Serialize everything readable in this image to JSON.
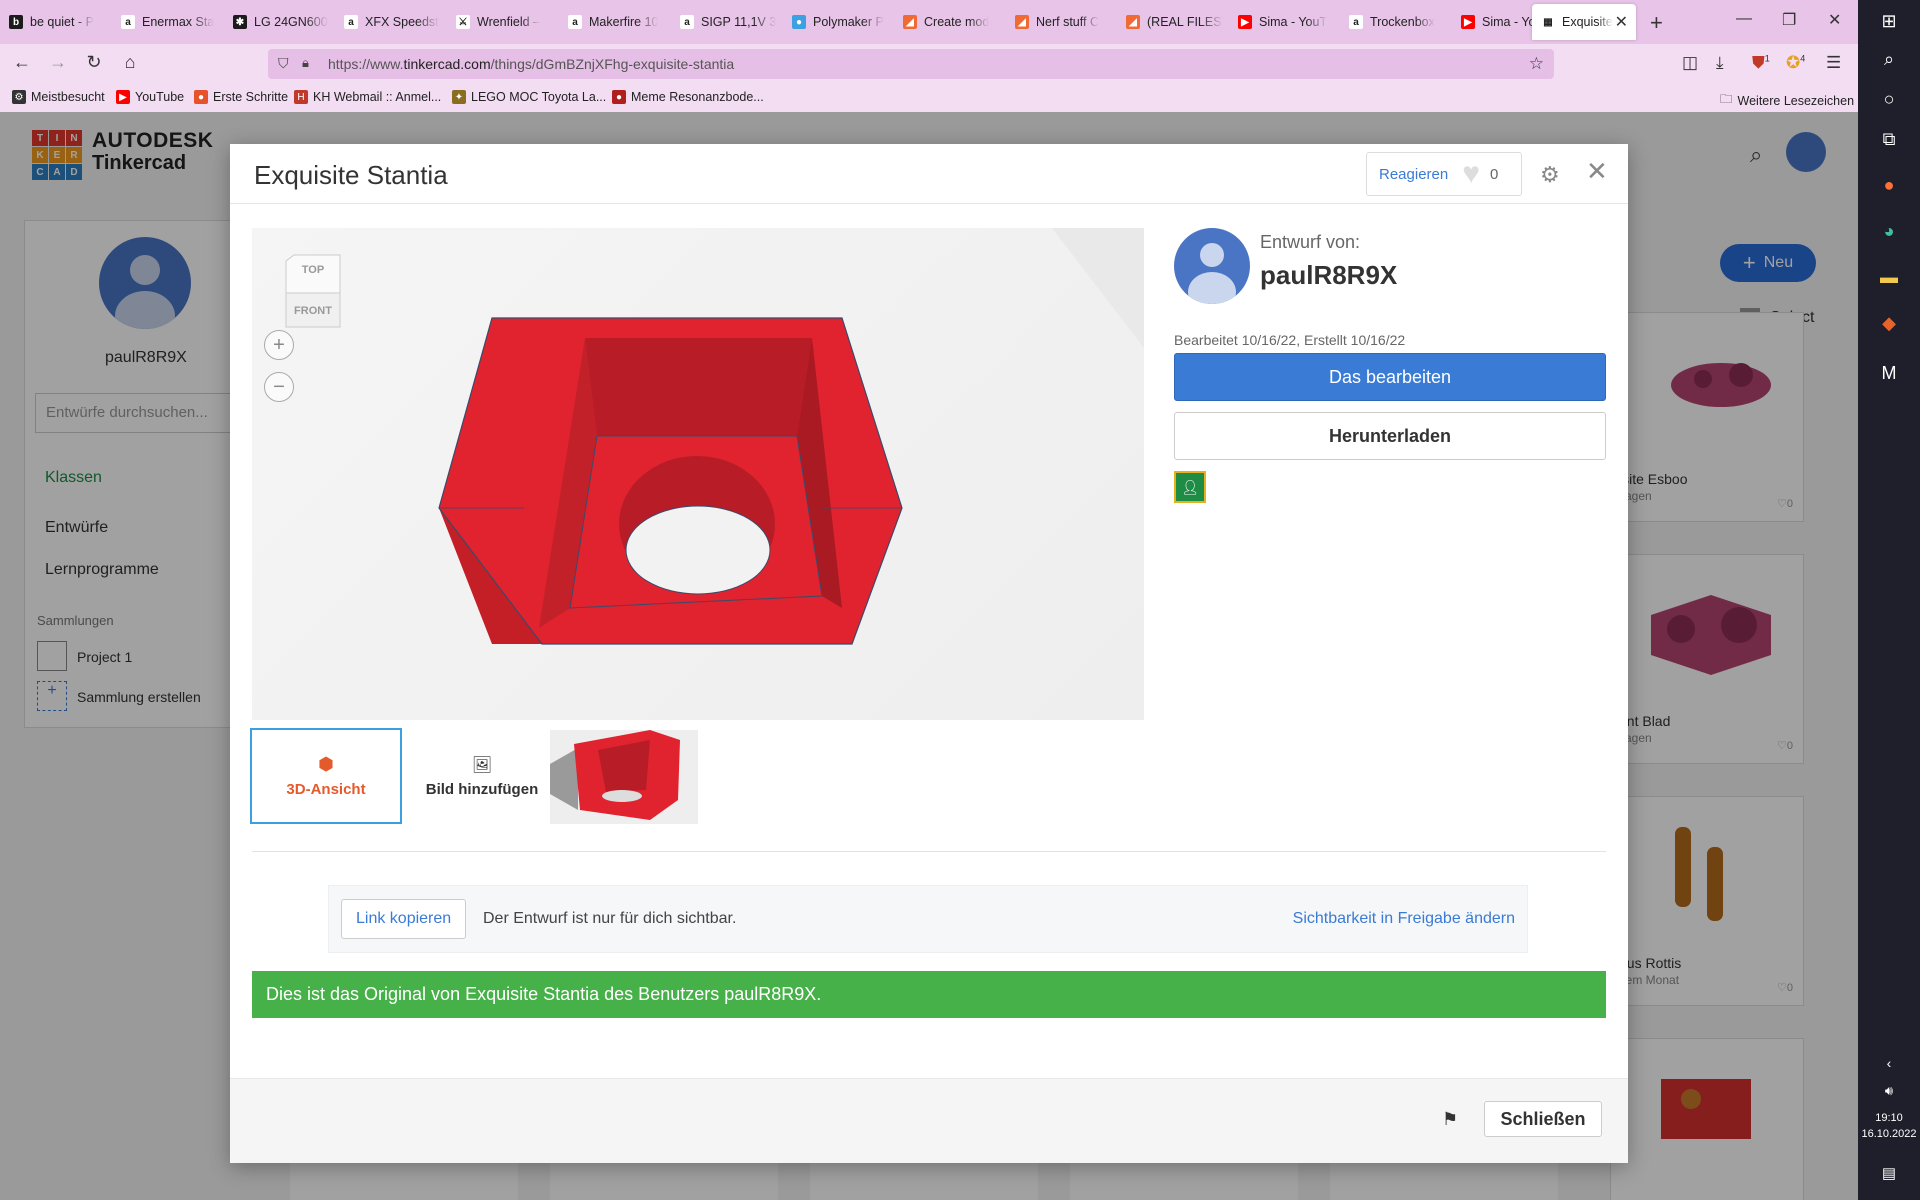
{
  "browser": {
    "tabs": [
      {
        "label": "be quiet - P",
        "icon": "bequiet-icon",
        "color": "#1b1b1b",
        "glyph": "b"
      },
      {
        "label": "Enermax Sta",
        "icon": "amazon-icon",
        "color": "#ffffff",
        "glyph": "a"
      },
      {
        "label": "LG 24GN600",
        "icon": "lg-icon",
        "color": "#1b1b1b",
        "glyph": "✱"
      },
      {
        "label": "XFX Speedst",
        "icon": "amazon-icon",
        "color": "#ffffff",
        "glyph": "a"
      },
      {
        "label": "Wrenfield –",
        "icon": "wrench-icon",
        "color": "#ffffff",
        "glyph": "⚔"
      },
      {
        "label": "Makerfire 10",
        "icon": "amazon-icon",
        "color": "#ffffff",
        "glyph": "a"
      },
      {
        "label": "SIGP 11,1V 3",
        "icon": "amazon-icon",
        "color": "#ffffff",
        "glyph": "a"
      },
      {
        "label": "Polymaker P",
        "icon": "polymaker-icon",
        "color": "#3da0e0",
        "glyph": "●"
      },
      {
        "label": "Create mod",
        "icon": "curseforge-icon",
        "color": "#f06a35",
        "glyph": "◢"
      },
      {
        "label": "Nerf stuff C",
        "icon": "curseforge-icon",
        "color": "#f06a35",
        "glyph": "◢"
      },
      {
        "label": "(REAL FILES)",
        "icon": "curseforge-icon",
        "color": "#f06a35",
        "glyph": "◢"
      },
      {
        "label": "Sima - YouT",
        "icon": "youtube-icon",
        "color": "#ff0000",
        "glyph": "▶"
      },
      {
        "label": "Trockenbox",
        "icon": "amazon-icon",
        "color": "#ffffff",
        "glyph": "a"
      },
      {
        "label": "Sima - YouT",
        "icon": "youtube-icon",
        "color": "#ff0000",
        "glyph": "▶"
      },
      {
        "label": "Exquisite",
        "icon": "tinkercad-icon",
        "color": "#ffffff",
        "glyph": "▦",
        "active": true
      }
    ],
    "url_prefix": "https://www.",
    "url_domain": "tinkercad.com",
    "url_path": "/things/dGmBZnjXFhg-exquisite-stantia",
    "bookmarks": [
      {
        "label": "Meistbesucht",
        "icon": "gear-icon",
        "color": "#333333",
        "glyph": "⚙"
      },
      {
        "label": "YouTube",
        "icon": "youtube-icon",
        "color": "#ff0000",
        "glyph": "▶"
      },
      {
        "label": "Erste Schritte",
        "icon": "firefox-icon",
        "color": "#e6522c",
        "glyph": "●"
      },
      {
        "label": "KH Webmail :: Anmel...",
        "icon": "webmail-icon",
        "color": "#c0392b",
        "glyph": "H"
      },
      {
        "label": "LEGO MOC Toyota La...",
        "icon": "lego-icon",
        "color": "#8a6d1e",
        "glyph": "✦"
      },
      {
        "label": "Meme Resonanzbode...",
        "icon": "record-icon",
        "color": "#b01e1e",
        "glyph": "●"
      }
    ],
    "more_bookmarks": "Weitere Lesezeichen",
    "badge_ext1": "1",
    "badge_ext2": "4"
  },
  "page": {
    "logo_letters": [
      "T",
      "I",
      "N",
      "K",
      "E",
      "R",
      "C",
      "A",
      "D"
    ],
    "logo_colors": [
      "#e2372c",
      "#e2372c",
      "#e2372c",
      "#f39c1f",
      "#f39c1f",
      "#f39c1f",
      "#2b7fc1",
      "#2b7fc1",
      "#2b7fc1"
    ],
    "logo_top": "AUTODESK",
    "logo_bottom": "Tinkercad",
    "sidebar_user": "paulR8R9X",
    "search_placeholder": "Entwürfe durchsuchen...",
    "nav_classes": "Klassen",
    "nav_designs": "Entwürfe",
    "nav_tutorials": "Lernprogramme",
    "collections_header": "Sammlungen",
    "collection_1": "Project 1",
    "collection_create": "Sammlung erstellen",
    "new_button": "Neu",
    "select_label": "Select",
    "cards": [
      {
        "name": "isite Esboo",
        "time": "Tagen",
        "likes": "0"
      },
      {
        "name": "ant Blad",
        "time": "Tagen",
        "likes": "0"
      },
      {
        "name": "ous Rottis",
        "time": "nem Monat",
        "likes": "0"
      }
    ]
  },
  "modal": {
    "title": "Exquisite Stantia",
    "react_label": "Reagieren",
    "react_count": "0",
    "viewcube_top": "TOP",
    "viewcube_front": "FRONT",
    "author_label": "Entwurf von:",
    "author_name": "paulR8R9X",
    "dates": "Bearbeitet 10/16/22, Erstellt 10/16/22",
    "edit_button": "Das bearbeiten",
    "download_button": "Herunterladen",
    "thumb_3d": "3D-Ansicht",
    "thumb_add": "Bild hinzufügen",
    "copy_link": "Link kopieren",
    "visibility_text": "Der Entwurf ist nur für dich sichtbar.",
    "change_visibility": "Sichtbarkeit in Freigabe ändern",
    "original_banner": "Dies ist das Original von Exquisite Stantia des Benutzers paulR8R9X.",
    "close_button": "Schließen",
    "colors": {
      "primary": "#3a7bd5",
      "banner": "#46b148",
      "model": "#e0232f",
      "thumb_active": "#e55a2b"
    }
  },
  "taskbar": {
    "time": "19:10",
    "date": "16.10.2022"
  }
}
